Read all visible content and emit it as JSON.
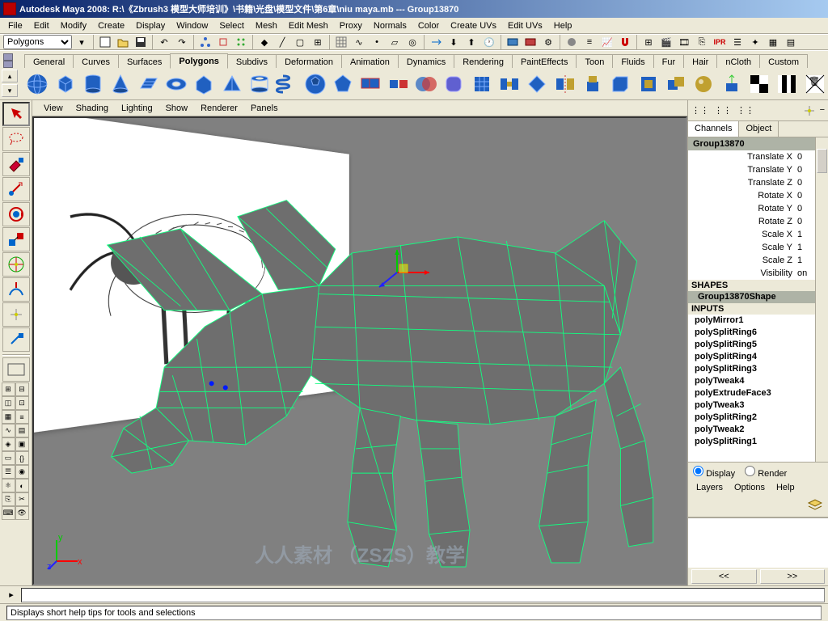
{
  "title": "Autodesk Maya 2008: R:\\《Zbrush3 模型大师培训》\\书籍\\光盘\\模型文件\\第6章\\niu maya.mb  ---  Group13870",
  "menus": [
    "File",
    "Edit",
    "Modify",
    "Create",
    "Display",
    "Window",
    "Select",
    "Mesh",
    "Edit Mesh",
    "Proxy",
    "Normals",
    "Color",
    "Create UVs",
    "Edit UVs",
    "Help"
  ],
  "mode_selector": "Polygons",
  "shelf_tabs": [
    "General",
    "Curves",
    "Surfaces",
    "Polygons",
    "Subdivs",
    "Deformation",
    "Animation",
    "Dynamics",
    "Rendering",
    "PaintEffects",
    "Toon",
    "Fluids",
    "Fur",
    "Hair",
    "nCloth",
    "Custom"
  ],
  "active_shelf": "Polygons",
  "panel_menus": [
    "View",
    "Shading",
    "Lighting",
    "Show",
    "Renderer",
    "Panels"
  ],
  "channels": {
    "tabs": [
      "Channels",
      "Object"
    ],
    "node": "Group13870",
    "attrs": [
      {
        "label": "Translate X",
        "value": "0"
      },
      {
        "label": "Translate Y",
        "value": "0"
      },
      {
        "label": "Translate Z",
        "value": "0"
      },
      {
        "label": "Rotate X",
        "value": "0"
      },
      {
        "label": "Rotate Y",
        "value": "0"
      },
      {
        "label": "Rotate Z",
        "value": "0"
      },
      {
        "label": "Scale X",
        "value": "1"
      },
      {
        "label": "Scale Y",
        "value": "1"
      },
      {
        "label": "Scale Z",
        "value": "1"
      },
      {
        "label": "Visibility",
        "value": "on"
      }
    ],
    "shapes_header": "SHAPES",
    "shape": "Group13870Shape",
    "inputs_header": "INPUTS",
    "inputs": [
      "polyMirror1",
      "polySplitRing6",
      "polySplitRing5",
      "polySplitRing4",
      "polySplitRing3",
      "polyTweak4",
      "polyExtrudeFace3",
      "polyTweak3",
      "polySplitRing2",
      "polyTweak2",
      "polySplitRing1"
    ]
  },
  "layer": {
    "display_label": "Display",
    "render_label": "Render",
    "menus": [
      "Layers",
      "Options",
      "Help"
    ],
    "btn_prev": "<<",
    "btn_next": ">>"
  },
  "help_text": "Displays short help tips for tools and selections",
  "watermark": "人人素材  （ZSZS）教学",
  "axis_labels": {
    "x": "x",
    "y": "y",
    "z": "z"
  }
}
